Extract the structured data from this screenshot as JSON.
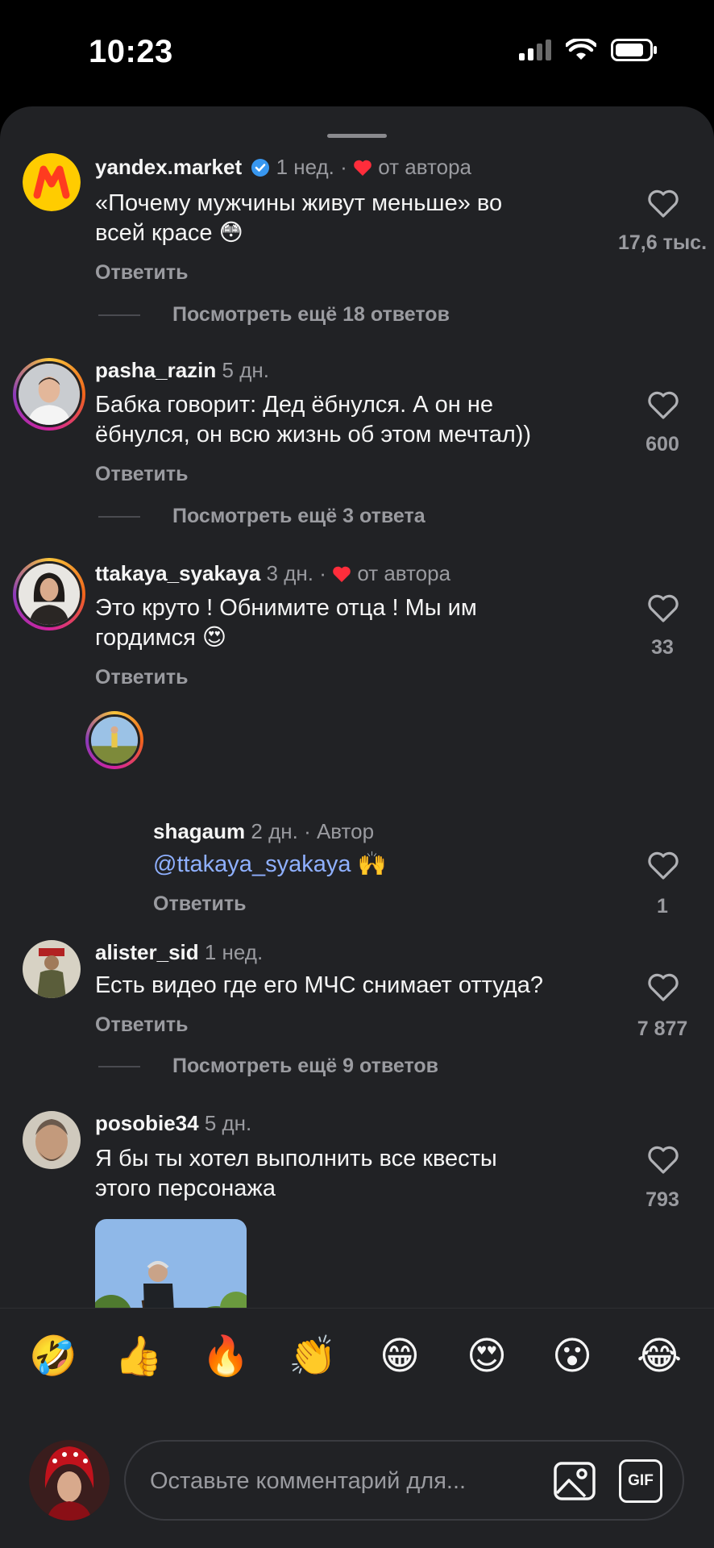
{
  "status_bar": {
    "time": "10:23"
  },
  "comments": [
    {
      "username": "yandex.market",
      "verified": true,
      "time": "1 нед.",
      "liked_by_author": "от автора",
      "text_lines": [
        "«Почему мужчины живут меньше» во",
        "всей красе 😳"
      ],
      "reply": "Ответить",
      "likes": "17,6 тыс.",
      "more_replies": "Посмотреть ещё 18 ответов"
    },
    {
      "username": "pasha_razin",
      "time": "5 дн.",
      "text_lines": [
        "Бабка говорит: Дед ёбнулся. А он не",
        "ёбнулся, он всю жизнь об этом мечтал))"
      ],
      "reply": "Ответить",
      "likes": "600",
      "more_replies": "Посмотреть ещё 3 ответа"
    },
    {
      "username": "ttakaya_syakaya",
      "time": "3 дн.",
      "liked_by_author": "от автора",
      "text_lines": [
        "Это круто ! Обнимите отца ! Мы им",
        "гордимся 😍"
      ],
      "reply": "Ответить",
      "likes": "33"
    },
    {
      "username": "shagaum",
      "time": "2 дн.",
      "author_badge": "Автор",
      "mention": "@ttakaya_syakaya",
      "text_after": " 🙌",
      "reply": "Ответить",
      "likes": "1"
    },
    {
      "username": "alister_sid",
      "time": "1 нед.",
      "text_lines": [
        "Есть видео где его МЧС снимает оттуда?"
      ],
      "reply": "Ответить",
      "likes": "7 877",
      "more_replies": "Посмотреть ещё 9 ответов"
    },
    {
      "username": "posobie34",
      "time": "5 дн.",
      "text_lines": [
        "Я бы ты хотел выполнить все квесты",
        "этого персонажа"
      ],
      "likes": "793"
    }
  ],
  "emoji_bar": [
    "🤣",
    "👍",
    "🔥",
    "👏",
    "😁",
    "😍",
    "😮",
    "😂"
  ],
  "composer": {
    "placeholder": "Оставьте комментарий для...",
    "gif_label": "GIF"
  },
  "colors": {
    "sheet_bg": "#212225",
    "muted": "#9a9ba0",
    "heart_red": "#ff2d3b",
    "mention": "#8fb0ff",
    "verified_blue": "#3897f0"
  }
}
